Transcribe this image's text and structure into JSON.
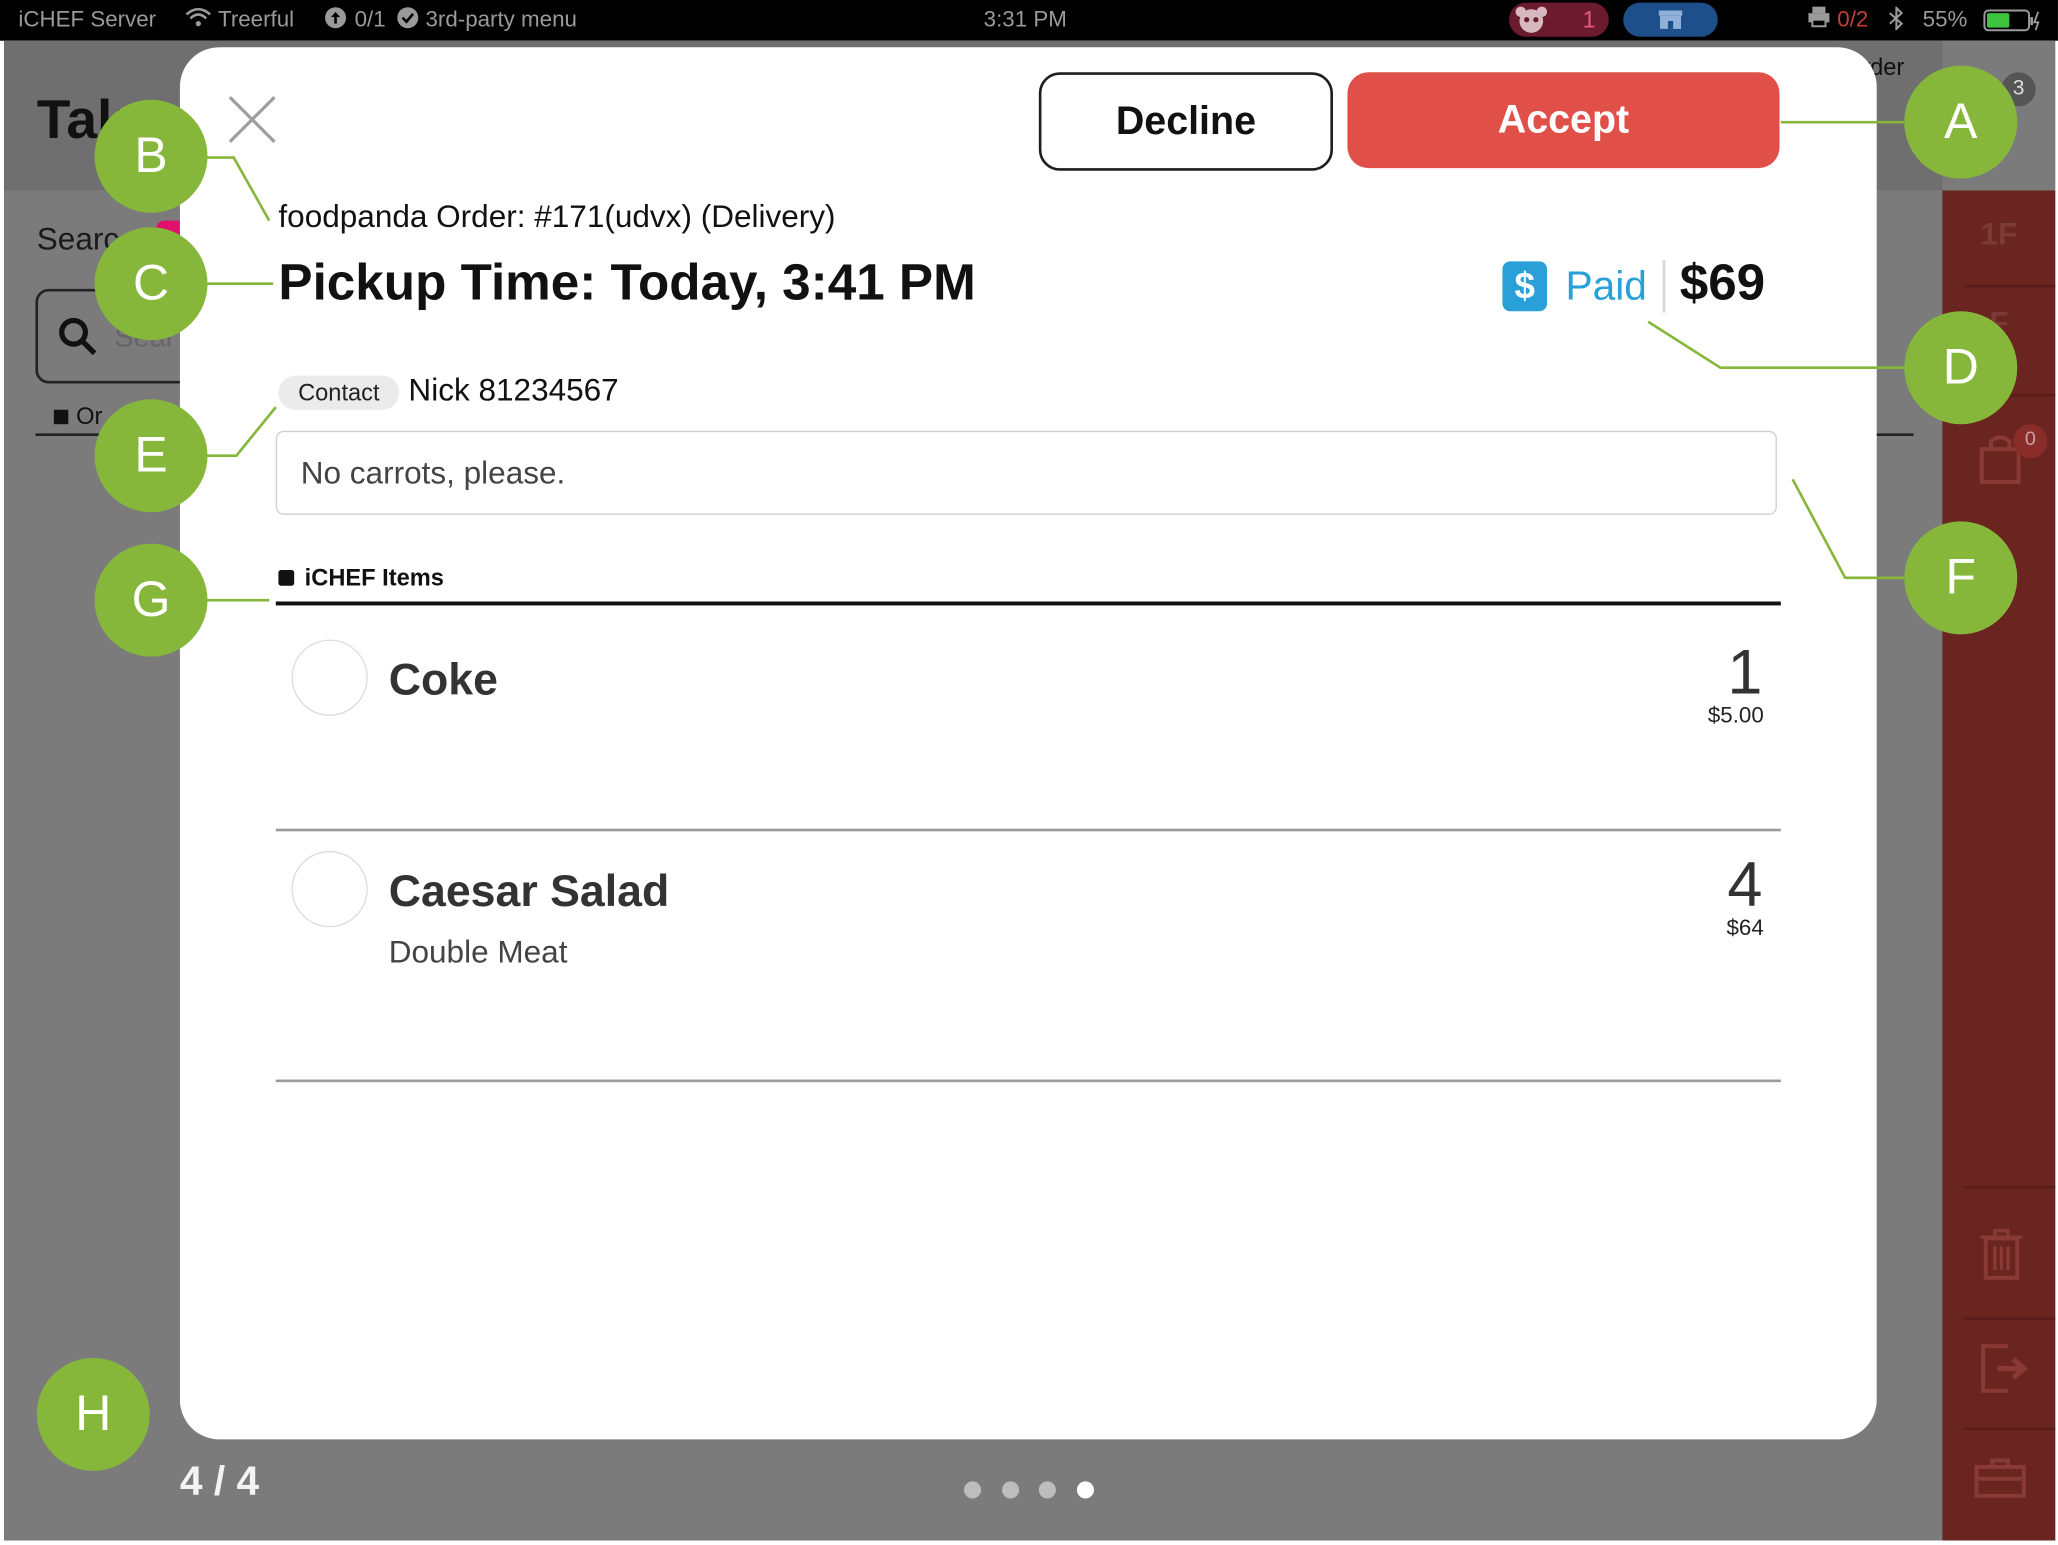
{
  "status_bar": {
    "app_name": "iCHEF Server",
    "wifi_name": "Treerful",
    "sync_count": "0/1",
    "menu_label": "3rd-party menu",
    "time": "3:31 PM",
    "foodpanda_count": "1",
    "printer_status": "0/2",
    "battery": "55%"
  },
  "background_app": {
    "title": "Tak",
    "search_label": "Searc",
    "search_placeholder": "Sear",
    "orders_label": "Or",
    "header_right": "rder",
    "notification_count": "3",
    "sidebar_floor_1": "1F",
    "sidebar_floor_2": "F",
    "cart_badge": "0"
  },
  "modal": {
    "decline_label": "Decline",
    "accept_label": "Accept",
    "order_line": "foodpanda Order: #171(udvx) (Delivery)",
    "pickup_time": "Pickup Time: Today, 3:41 PM",
    "payment_icon": "$",
    "paid_label": "Paid",
    "total": "$69",
    "contact_tag": "Contact",
    "contact_info": "Nick 81234567",
    "note": "No carrots, please.",
    "section_title": "iCHEF Items",
    "items": [
      {
        "name": "Coke",
        "modifier": "",
        "qty": "1",
        "price": "$5.00"
      },
      {
        "name": "Caesar Salad",
        "modifier": "Double Meat",
        "qty": "4",
        "price": "$64"
      }
    ]
  },
  "paging": {
    "page_count": "4 / 4",
    "pages": 4,
    "active_page": 4
  },
  "callouts": [
    "A",
    "B",
    "C",
    "D",
    "E",
    "F",
    "G",
    "H"
  ],
  "colors": {
    "accept": "#e05048",
    "paid": "#2aa0d8",
    "callout": "#86b73b",
    "sidebar": "#6a2520",
    "foodpanda": "#e2106a"
  },
  "icons": [
    "close-icon",
    "wifi-icon",
    "sync-icon",
    "check-circle-icon",
    "foodpanda-icon",
    "store-icon",
    "printer-icon",
    "bluetooth-icon",
    "battery-icon",
    "search-icon",
    "dollar-icon",
    "bag-icon",
    "trash-icon",
    "logout-icon",
    "toolbox-icon"
  ]
}
